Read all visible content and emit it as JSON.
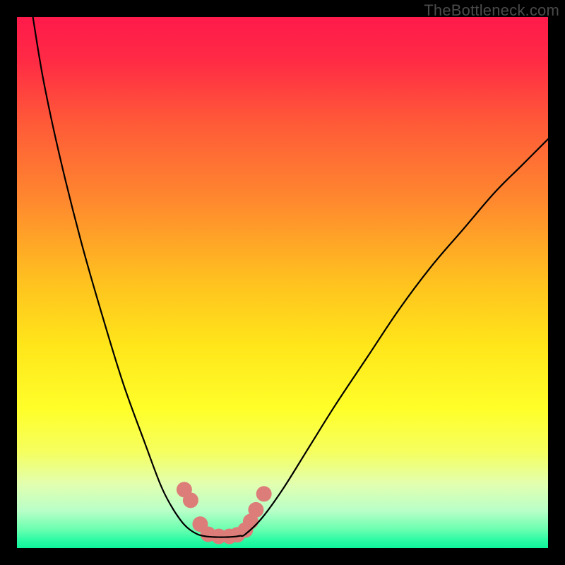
{
  "watermark": {
    "text": "TheBottleneck.com"
  },
  "colors": {
    "frame": "#000000",
    "curve": "#000000",
    "marker_fill": "#dd7d79",
    "marker_stroke": "#c25a56",
    "gradient_stops": [
      {
        "offset": 0.0,
        "color": "#ff1a4b"
      },
      {
        "offset": 0.08,
        "color": "#ff2a45"
      },
      {
        "offset": 0.2,
        "color": "#ff5a38"
      },
      {
        "offset": 0.35,
        "color": "#ff8a2e"
      },
      {
        "offset": 0.5,
        "color": "#ffc21f"
      },
      {
        "offset": 0.62,
        "color": "#ffe61a"
      },
      {
        "offset": 0.74,
        "color": "#ffff2a"
      },
      {
        "offset": 0.82,
        "color": "#f5ff60"
      },
      {
        "offset": 0.88,
        "color": "#e2ffb0"
      },
      {
        "offset": 0.93,
        "color": "#b8ffc8"
      },
      {
        "offset": 0.965,
        "color": "#6affb0"
      },
      {
        "offset": 0.985,
        "color": "#2cfaa4"
      },
      {
        "offset": 1.0,
        "color": "#0ef59a"
      }
    ]
  },
  "chart_data": {
    "type": "line",
    "title": "",
    "xlabel": "",
    "ylabel": "",
    "xlim": [
      0,
      100
    ],
    "ylim": [
      0,
      100
    ],
    "series": [
      {
        "name": "left-curve",
        "x": [
          3,
          5,
          8,
          12,
          16,
          20,
          24,
          27,
          29,
          31,
          32.5,
          34,
          35
        ],
        "values": [
          100,
          88,
          74,
          58,
          44,
          31,
          20,
          12,
          8,
          5,
          3.5,
          2.6,
          2.3
        ]
      },
      {
        "name": "valley-floor",
        "x": [
          35,
          36,
          37,
          38,
          39,
          40,
          41,
          42,
          43
        ],
        "values": [
          2.3,
          2.15,
          2.08,
          2.05,
          2.05,
          2.08,
          2.15,
          2.3,
          2.6
        ]
      },
      {
        "name": "right-curve",
        "x": [
          43,
          46,
          50,
          55,
          60,
          66,
          72,
          78,
          84,
          90,
          95,
          100
        ],
        "values": [
          2.6,
          5.5,
          11,
          19,
          27,
          36,
          45,
          53,
          60,
          67,
          72,
          77
        ]
      }
    ],
    "markers": {
      "name": "marker-dots",
      "x": [
        31.5,
        32.7,
        34.5,
        36.0,
        38.0,
        40.0,
        41.5,
        43.0,
        44.0,
        45.0,
        46.5
      ],
      "values": [
        11.0,
        9.0,
        4.5,
        2.6,
        2.2,
        2.2,
        2.5,
        3.4,
        5.0,
        7.2,
        10.2
      ],
      "radius": 11
    }
  }
}
